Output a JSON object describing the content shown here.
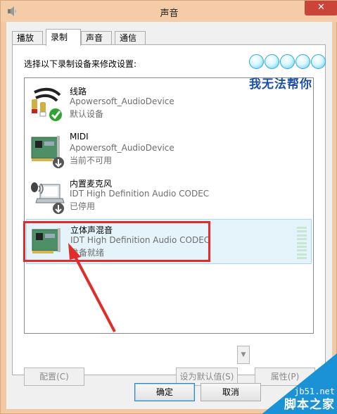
{
  "window": {
    "title": "声音",
    "close_glyph": "✕"
  },
  "tabs": [
    {
      "label": "播放"
    },
    {
      "label": "录制"
    },
    {
      "label": "声音"
    },
    {
      "label": "通信"
    }
  ],
  "instruction": "选择以下录制设备来修改设置:",
  "devices": [
    {
      "name": "线路",
      "driver": "Apowersoft_AudioDevice",
      "status": "默认设备",
      "icon": "line-in-icon",
      "badge": "default-check-icon"
    },
    {
      "name": "MIDI",
      "driver": "Apowersoft_AudioDevice",
      "status": "当前不可用",
      "icon": "sound-card-icon",
      "badge": "unavailable-arrow-icon"
    },
    {
      "name": "内置麦克风",
      "driver": "IDT High Definition Audio CODEC",
      "status": "已停用",
      "icon": "microphone-laptop-icon",
      "badge": "disabled-arrow-icon"
    },
    {
      "name": "立体声混音",
      "driver": "IDT High Definition Audio CODEC",
      "status": "准备就绪",
      "icon": "sound-card-icon",
      "badge": ""
    }
  ],
  "overlay": {
    "text": "我无法帮你"
  },
  "buttons": {
    "configure": "配置(C)",
    "set_default": "设为默认值(S)",
    "properties": "属性(P)",
    "ok": "确定",
    "cancel": "取消"
  },
  "watermark": {
    "site": "jb51.net",
    "text": "脚本之家"
  },
  "colors": {
    "title_bar": "#f4cda8",
    "close": "#c9453a",
    "highlight": "#e22b2b",
    "selection": "#e5f3fb"
  }
}
